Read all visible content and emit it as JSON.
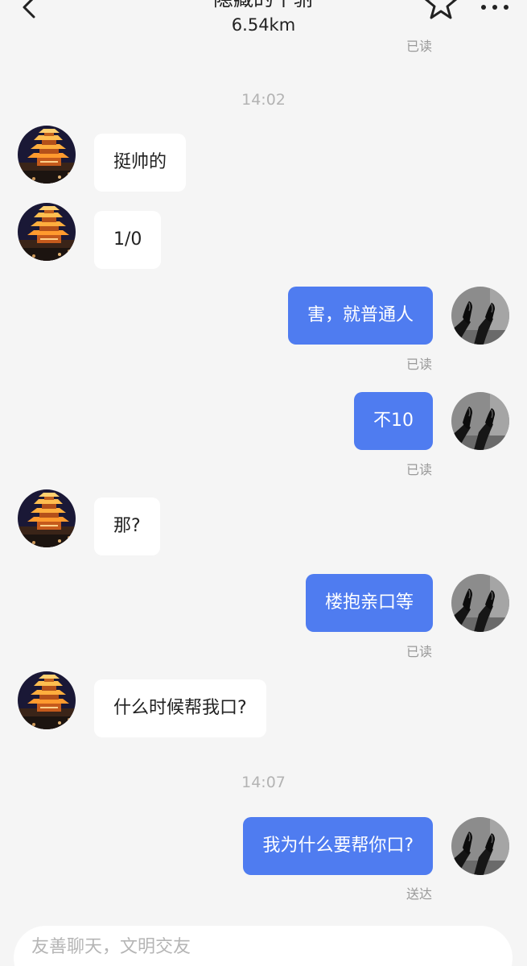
{
  "header": {
    "title": "隐藏的个驸",
    "distance": "6.54km",
    "icons": {
      "back": "chevron-left-icon",
      "favorite": "star-outline-icon",
      "more": "more-dots-icon"
    }
  },
  "colors": {
    "background": "#f5f5f5",
    "outgoing_bubble": "#4f7cf0",
    "incoming_bubble": "#ffffff",
    "meta_text": "#999999"
  },
  "chat": {
    "top_read_status": "已读",
    "time_1": "14:02",
    "time_2": "14:07",
    "messages": [
      {
        "from": "them",
        "text": "挺帅的"
      },
      {
        "from": "them",
        "text": "1/0"
      },
      {
        "from": "me",
        "text": "害，就普通人",
        "status": "已读"
      },
      {
        "from": "me",
        "text": "不10",
        "status": "已读"
      },
      {
        "from": "them",
        "text": "那?"
      },
      {
        "from": "me",
        "text": "楼抱亲口等",
        "status": "已读"
      },
      {
        "from": "them",
        "text": "什么时候帮我口?"
      },
      {
        "from": "me",
        "text": "我为什么要帮你口?",
        "status": "送达"
      }
    ]
  },
  "input": {
    "placeholder": "友善聊天，文明交友"
  }
}
